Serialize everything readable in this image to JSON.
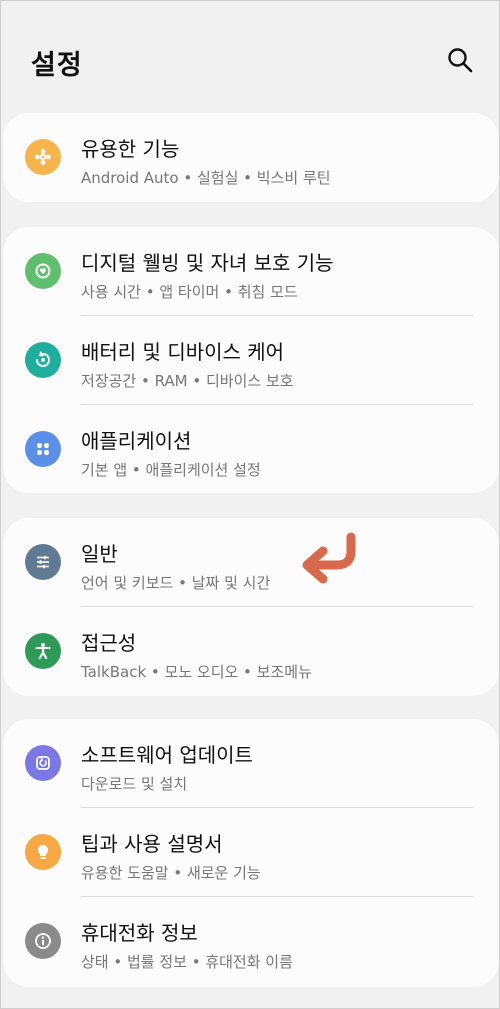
{
  "header": {
    "title": "설정",
    "search_icon": "search-icon"
  },
  "colors": {
    "background": "#f1f1f1",
    "card": "#fcfcfc",
    "orange": "#f6b44c",
    "green": "#5fbf6e",
    "teal": "#1fae9c",
    "blue": "#5b8fe8",
    "slate": "#607a94",
    "darkgreen": "#2f9a57",
    "purple": "#7b78e6",
    "gray": "#8a8a8a",
    "arrow": "#d9694c"
  },
  "groups": [
    {
      "items": [
        {
          "label": "유용한 기능",
          "sub": "Android Auto • 실험실 • 빅스비 루틴",
          "icon": "puzzle-icon"
        }
      ]
    },
    {
      "items": [
        {
          "label": "디지털 웰빙 및 자녀 보호 기능",
          "sub": "사용 시간 • 앱 타이머 • 취침 모드",
          "icon": "digital-wellbeing-icon"
        },
        {
          "label": "배터리 및 디바이스 케어",
          "sub": "저장공간 • RAM • 디바이스 보호",
          "icon": "device-care-icon"
        },
        {
          "label": "애플리케이션",
          "sub": "기본 앱 • 애플리케이션 설정",
          "icon": "apps-grid-icon"
        }
      ]
    },
    {
      "items": [
        {
          "label": "일반",
          "sub": "언어 및 키보드 • 날짜 및 시간",
          "icon": "sliders-icon"
        },
        {
          "label": "접근성",
          "sub": "TalkBack • 모노 오디오 • 보조메뉴",
          "icon": "accessibility-icon"
        }
      ]
    },
    {
      "items": [
        {
          "label": "소프트웨어 업데이트",
          "sub": "다운로드 및 설치",
          "icon": "update-icon"
        },
        {
          "label": "팁과 사용 설명서",
          "sub": "유용한 도움말 • 새로운 기능",
          "icon": "lightbulb-icon"
        },
        {
          "label": "휴대전화 정보",
          "sub": "상태 • 법률 정보 • 휴대전화 이름",
          "icon": "info-icon"
        }
      ]
    }
  ]
}
